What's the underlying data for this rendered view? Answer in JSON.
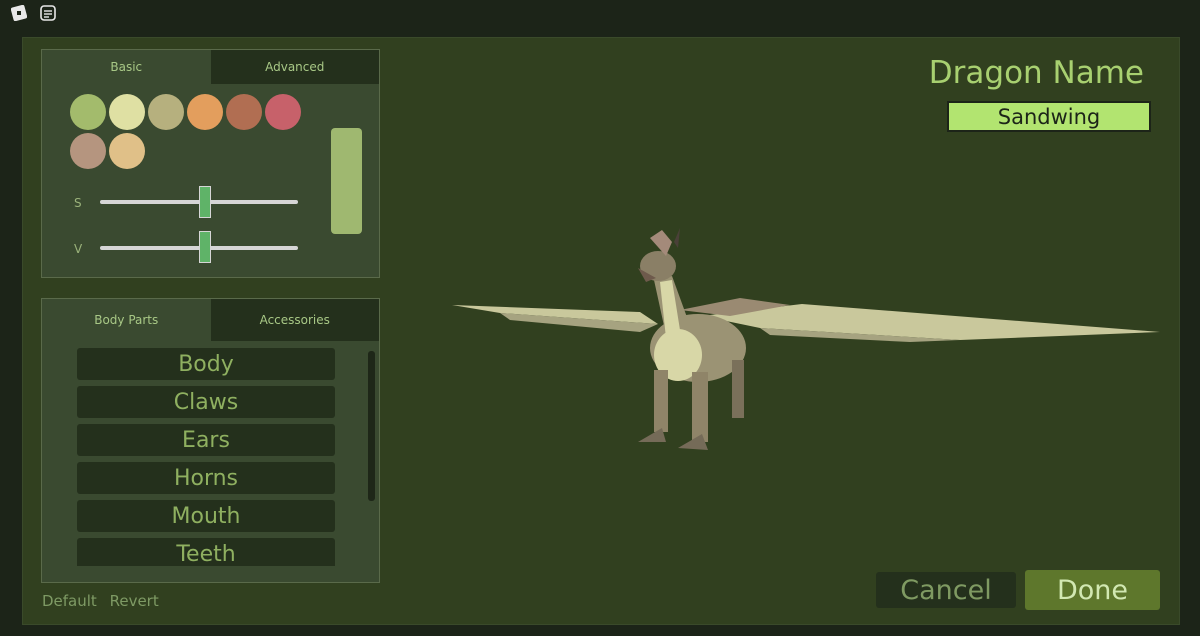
{
  "customizer": {
    "color_tabs": [
      "Basic",
      "Advanced"
    ],
    "swatches": [
      "#a3bb6c",
      "#dfe0a3",
      "#b6b07e",
      "#e39e5d",
      "#b16e52",
      "#c7616a",
      "#b5957f",
      "#e0c088"
    ],
    "slider_s_label": "S",
    "slider_v_label": "V",
    "slider_s_value": 0.53,
    "slider_v_value": 0.53,
    "selected_color": "#9fb870",
    "parts_tabs": [
      "Body Parts",
      "Accessories"
    ],
    "parts": [
      "Body",
      "Claws",
      "Ears",
      "Horns",
      "Mouth",
      "Teeth"
    ],
    "default_label": "Default",
    "revert_label": "Revert"
  },
  "header": {
    "title": "Dragon Name",
    "name_value": "Sandwing"
  },
  "actions": {
    "cancel_label": "Cancel",
    "done_label": "Done"
  }
}
